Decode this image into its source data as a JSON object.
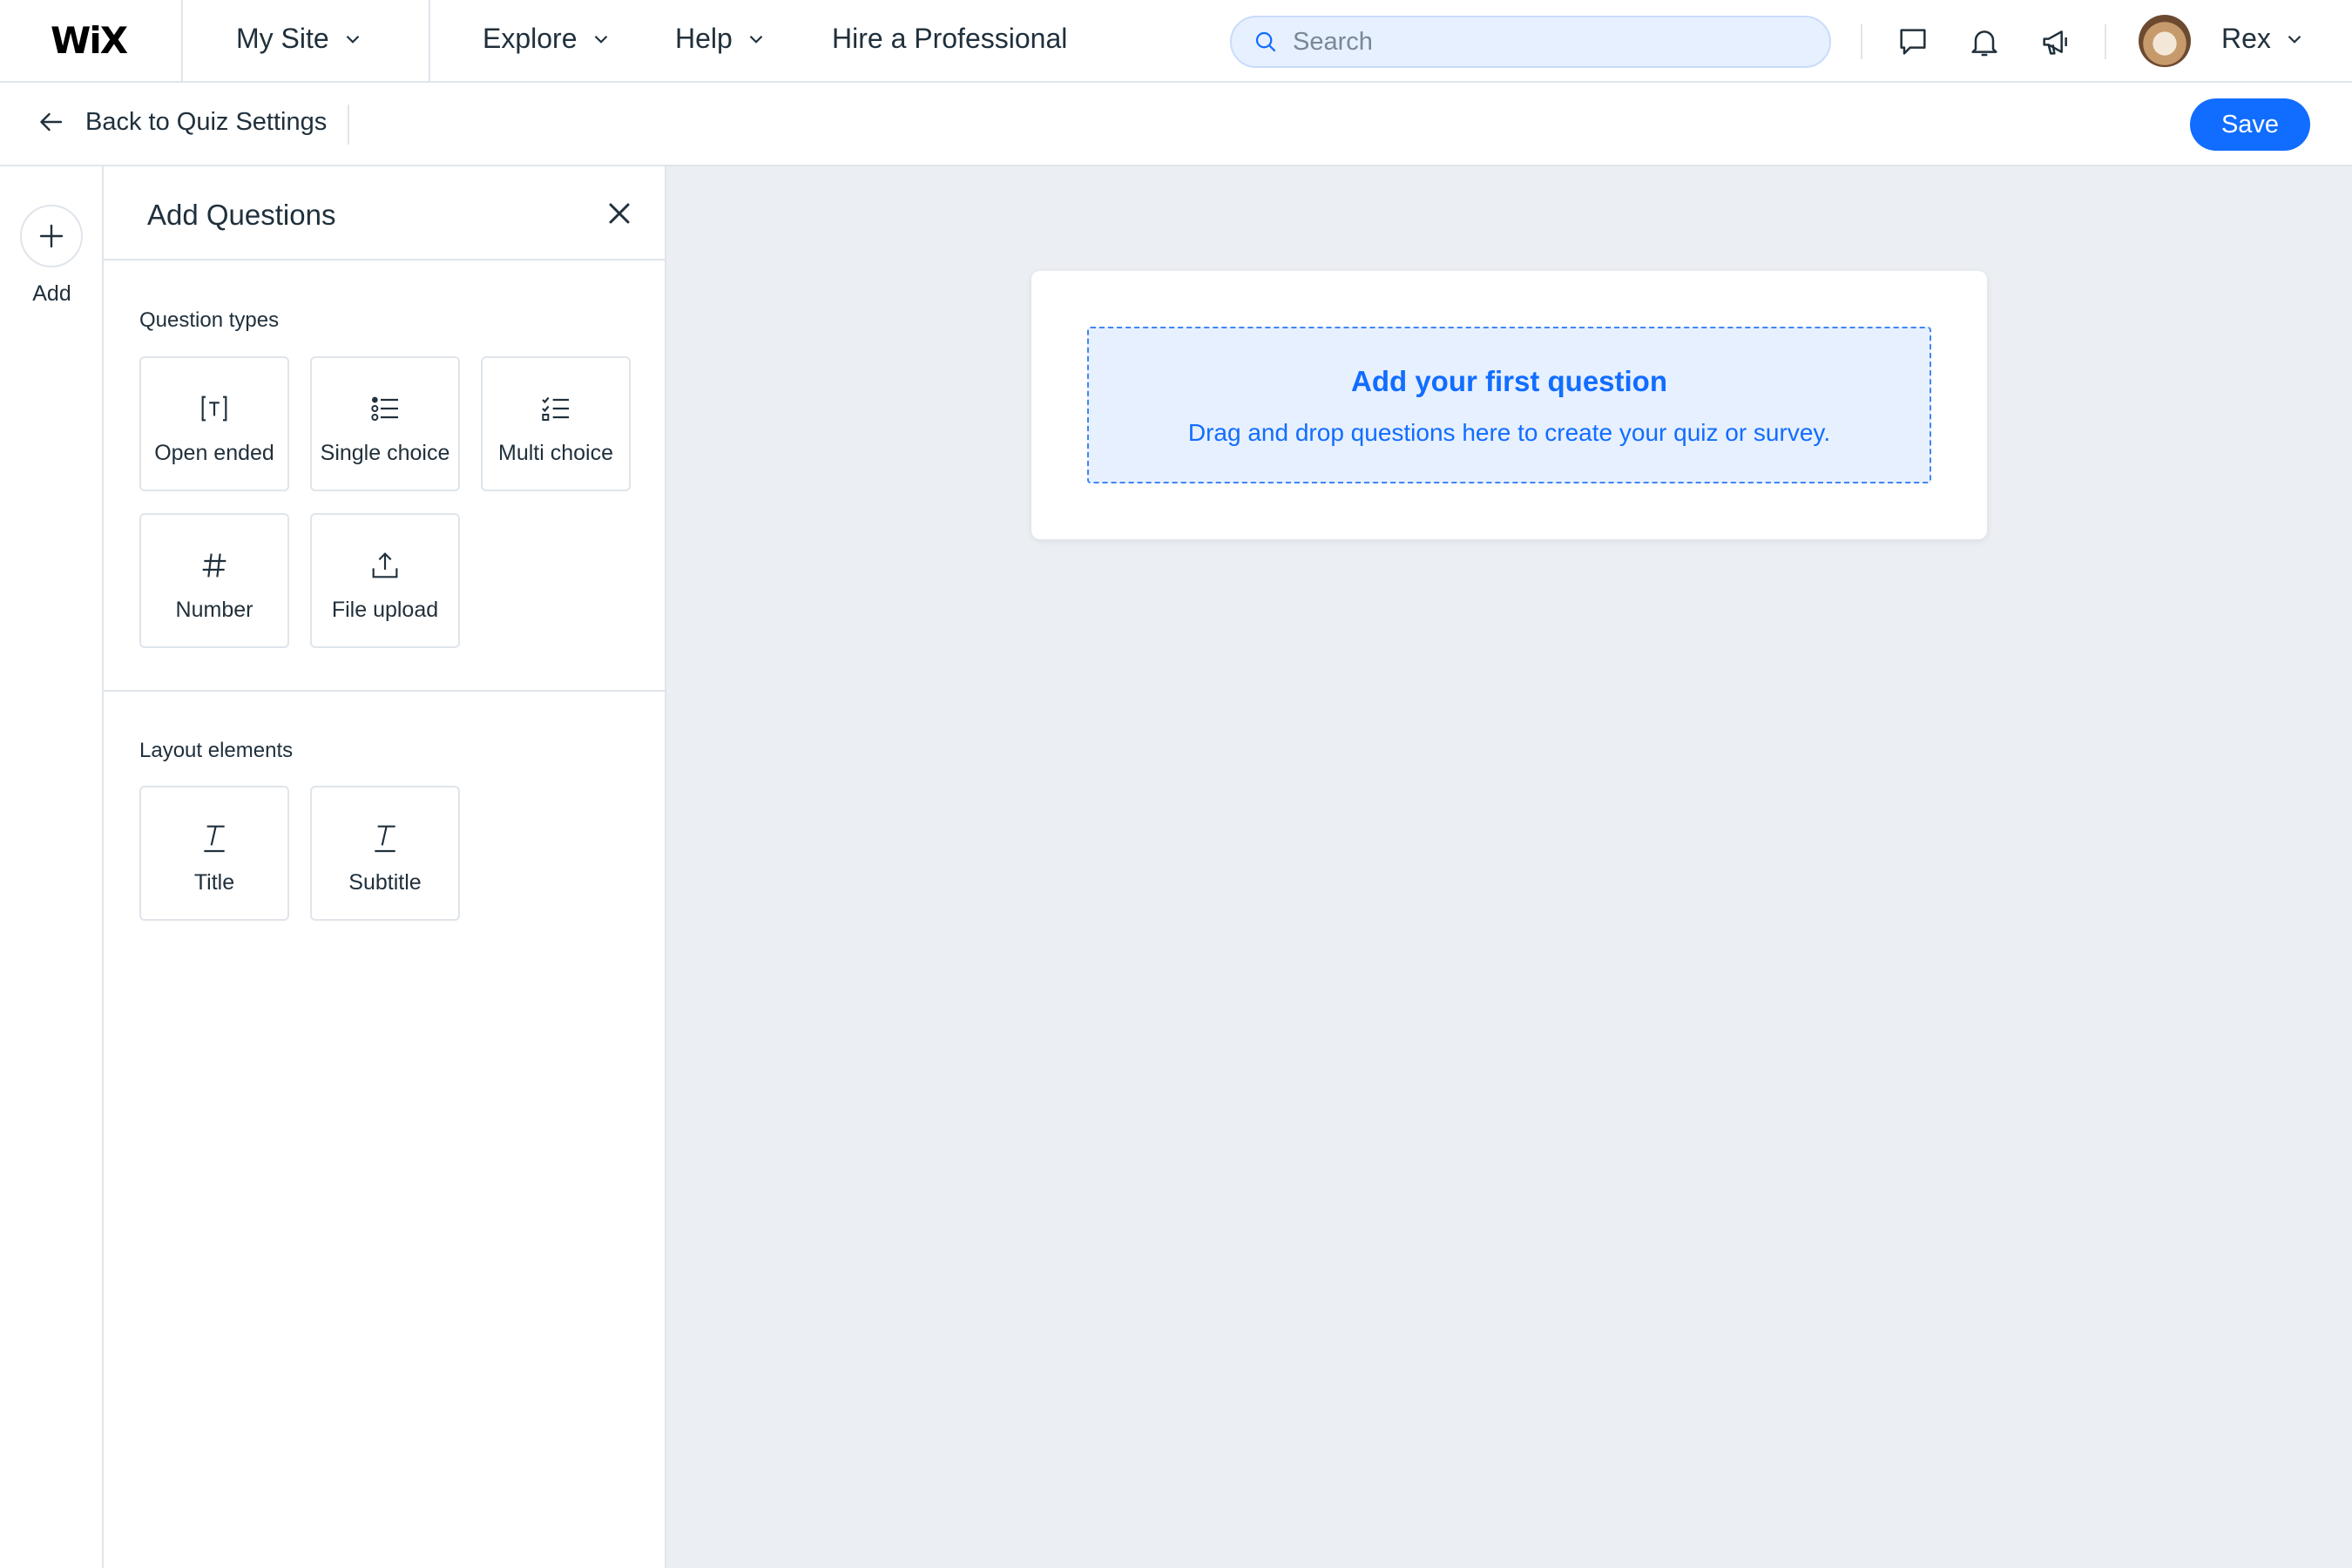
{
  "topbar": {
    "logo": "WiX",
    "site_menu": "My Site",
    "nav": [
      "Explore",
      "Help",
      "Hire a Professional"
    ],
    "search_placeholder": "Search",
    "icons": [
      "chat-icon",
      "bell-icon",
      "megaphone-icon"
    ],
    "user_name": "Rex"
  },
  "subbar": {
    "back_label": "Back to Quiz Settings",
    "save_label": "Save"
  },
  "rail": {
    "add_label": "Add"
  },
  "panel": {
    "title": "Add Questions",
    "question_types_label": "Question types",
    "question_types": [
      {
        "label": "Open ended",
        "icon": "text-bracket-icon"
      },
      {
        "label": "Single choice",
        "icon": "single-choice-list-icon"
      },
      {
        "label": "Multi choice",
        "icon": "multi-choice-list-icon"
      },
      {
        "label": "Number",
        "icon": "hash-icon"
      },
      {
        "label": "File upload",
        "icon": "upload-icon"
      }
    ],
    "layout_elements_label": "Layout elements",
    "layout_elements": [
      {
        "label": "Title",
        "icon": "title-text-icon"
      },
      {
        "label": "Subtitle",
        "icon": "subtitle-text-icon"
      }
    ]
  },
  "canvas": {
    "dropzone_title": "Add your first question",
    "dropzone_subtitle": "Drag and drop questions here to create your quiz or survey."
  },
  "colors": {
    "accent": "#116dff",
    "canvas_bg": "#ebeef3",
    "border": "#dfe5eb",
    "dropzone_bg": "#e7f0ff"
  }
}
